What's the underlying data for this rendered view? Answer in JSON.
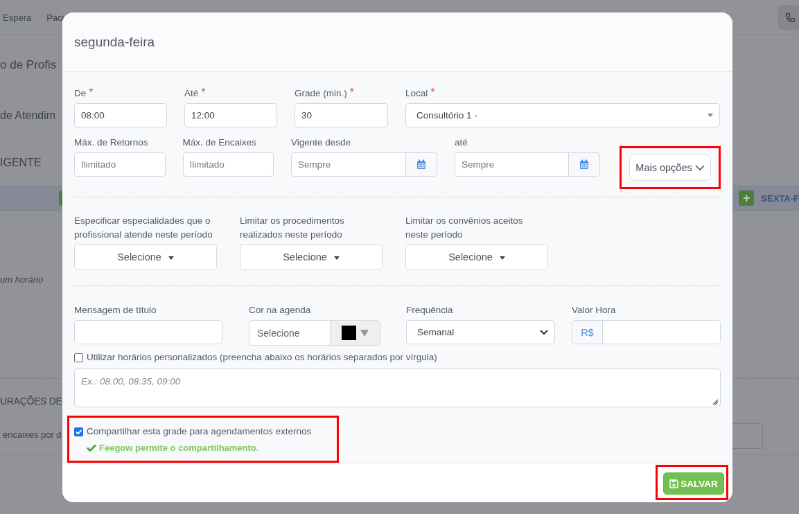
{
  "background": {
    "nav_items": [
      "Espera",
      "Paci"
    ],
    "heading": "o de Profis",
    "subheading": "de Atendim",
    "section": "IGENTE",
    "add_label": "+",
    "day_header": "SEXTA-F",
    "empty_hint": "um horário",
    "section_2": "URAÇÕES DE",
    "setting_label": "encaixes por d"
  },
  "modal": {
    "title": "segunda-feira",
    "row_1": [
      {
        "label": "De",
        "required_mark": "*",
        "value": "08:00",
        "kind": "text"
      },
      {
        "label": "Até",
        "required_mark": "*",
        "value": "12:00",
        "kind": "text"
      },
      {
        "label": "Grade (min.)",
        "required_mark": "*",
        "value": "30",
        "kind": "text"
      },
      {
        "label": "Local",
        "required_mark": "*",
        "value": "Consultório 1 -",
        "kind": "select"
      }
    ],
    "row_2": [
      {
        "label": "Máx. de Retornos",
        "placeholder": "Ilimitado",
        "kind": "text"
      },
      {
        "label": "Máx. de Encaixes",
        "placeholder": "Ilimitado",
        "kind": "text"
      },
      {
        "label": "Vigente desde",
        "placeholder": "Sempre",
        "kind": "date"
      },
      {
        "label": "até",
        "placeholder": "Sempre",
        "kind": "date"
      }
    ],
    "more_options": {
      "label": "Mais opções",
      "highlighted": true
    },
    "filters": [
      {
        "label": "Especificar especialidades que o profissional atende neste período",
        "button": "Selecione"
      },
      {
        "label": "Limitar os procedimentos realizados neste período",
        "button": "Selecione"
      },
      {
        "label": "Limitar os convênios aceitos neste período",
        "button": "Selecione"
      }
    ],
    "title_message": {
      "label": "Mensagem de título"
    },
    "agenda_color": {
      "label": "Cor na agenda",
      "placeholder": "Selecione"
    },
    "frequency": {
      "label": "Frequência",
      "value": "Semanal"
    },
    "hourly_value": {
      "label": "Valor Hora",
      "prefix": "R$"
    },
    "custom_times": {
      "label": "Utilizar horários personalizados (preencha abaixo os horários separados por vírgula)",
      "checked": false,
      "placeholder": "Ex.: 08:00, 08:35, 09:00"
    },
    "share": {
      "label": "Compartilhar esta grade para agendamentos externos",
      "checked": true,
      "status": "Feegow permite o compartilhamento.",
      "highlighted": true
    },
    "save_button": {
      "label": "SALVAR",
      "highlighted": true
    }
  }
}
